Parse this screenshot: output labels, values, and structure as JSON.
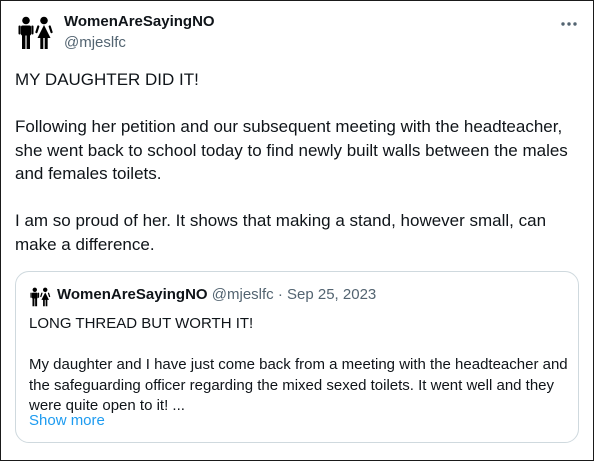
{
  "tweet": {
    "author_name": "WomenAreSayingNO",
    "author_handle": "@mjeslfc",
    "paragraphs": [
      "MY DAUGHTER DID IT!",
      "Following her petition and our subsequent meeting with the headteacher, she went back to school today to find newly built walls between the males and females toilets.",
      "I am so proud of her. It shows that making a stand, however small, can make a difference."
    ]
  },
  "quoted_tweet": {
    "author_name": "WomenAreSayingNO",
    "author_handle": "@mjeslfc",
    "separator": "·",
    "date": "Sep 25, 2023",
    "paragraphs": [
      "LONG THREAD BUT WORTH IT!",
      "My daughter and I have just come back from a meeting with the headteacher and the safeguarding officer regarding the mixed sexed toilets. It went well and they were quite open to it! ..."
    ],
    "show_more_label": "Show more"
  },
  "icons": {
    "avatar": "male-female-toilet-icon",
    "more": "more-options-icon"
  },
  "colors": {
    "text": "#0f1419",
    "secondary": "#536471",
    "link": "#1d9bf0",
    "quote_border": "#cfd9de"
  }
}
